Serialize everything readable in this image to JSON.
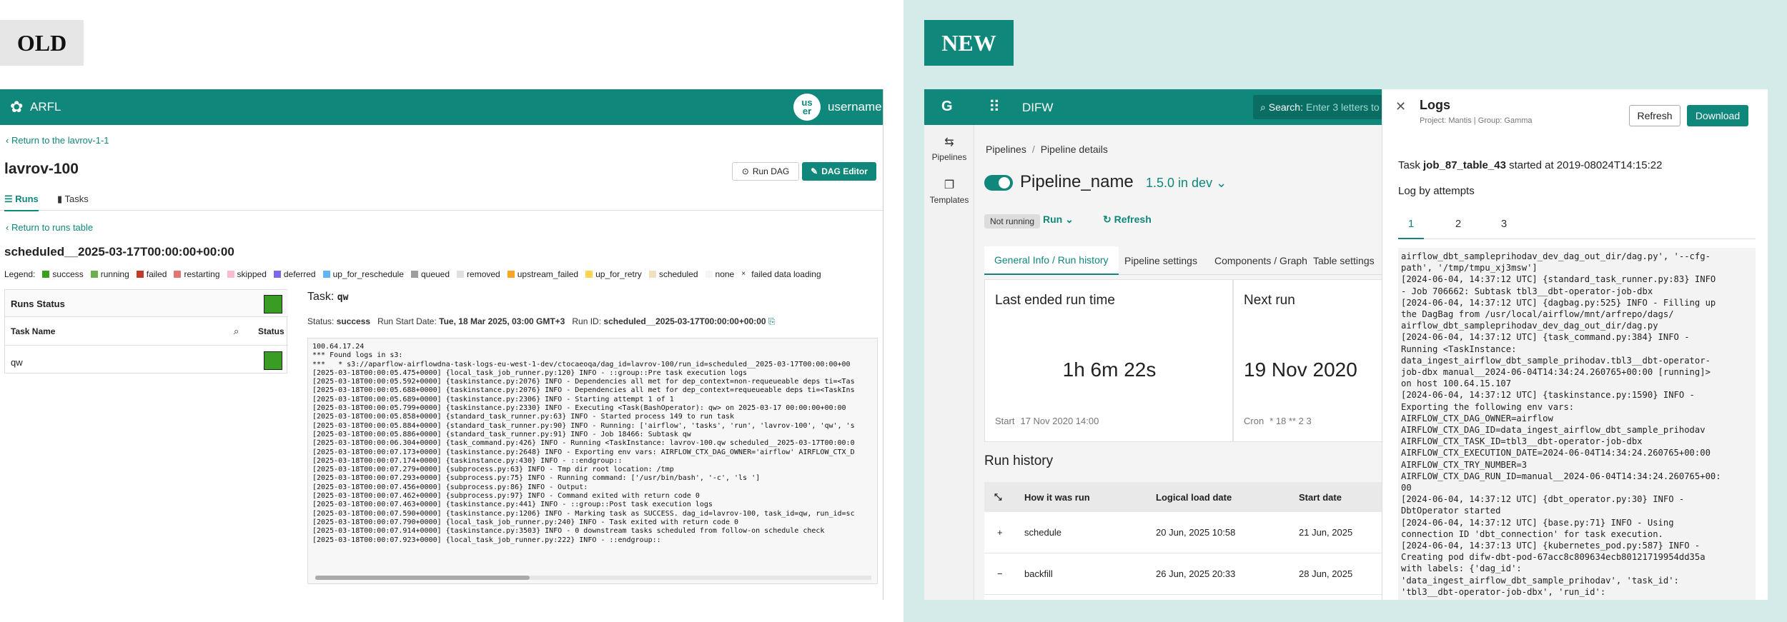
{
  "labels": {
    "old": "OLD",
    "new": "NEW"
  },
  "old": {
    "app_title": "ARFL",
    "avatar_text": "us\ner",
    "username": "username",
    "back_link": "Return to the lavrov-1-1",
    "dag_name": "lavrov-100",
    "run_dag_label": "Run DAG",
    "dag_editor_label": "DAG Editor",
    "tabs": [
      {
        "label": "Runs"
      },
      {
        "label": "Tasks"
      }
    ],
    "back_runs": "Return to runs table",
    "run_title": "scheduled__2025-03-17T00:00:00+00:00",
    "legend_title": "Legend:",
    "legend": [
      {
        "label": "success",
        "color": "#3a9d23"
      },
      {
        "label": "running",
        "color": "#6ab04c"
      },
      {
        "label": "failed",
        "color": "#c0392b"
      },
      {
        "label": "restarting",
        "color": "#e57373"
      },
      {
        "label": "skipped",
        "color": "#f8bbd0"
      },
      {
        "label": "deferred",
        "color": "#7b68ee"
      },
      {
        "label": "up_for_reschedule",
        "color": "#64b5f6"
      },
      {
        "label": "queued",
        "color": "#9e9e9e"
      },
      {
        "label": "removed",
        "color": "#e0e0e0"
      },
      {
        "label": "upstream_failed",
        "color": "#f5a623"
      },
      {
        "label": "up_for_retry",
        "color": "#ffd54f"
      },
      {
        "label": "scheduled",
        "color": "#f0e0c0"
      },
      {
        "label": "none",
        "color": "#f5f5f5"
      },
      {
        "label": "failed data loading",
        "color": "#ffffff"
      }
    ],
    "runs_status_label": "Runs Status",
    "task_name_label": "Task Name",
    "status_label": "Status",
    "task_row": "qw",
    "task_title": "Task:",
    "task_title_value": "qw",
    "status_key": "Status:",
    "status_val": "success",
    "start_key": "Run Start Date:",
    "start_val": "Tue, 18 Mar 2025, 03:00 GMT+3",
    "runid_key": "Run ID:",
    "runid_val": "scheduled__2025-03-17T00:00:00+00:00",
    "log_lines": [
      "100.64.17.24",
      "*** Found logs in s3:",
      "***   * s3://aparflow-airflowdna-task-logs-eu-west-1-dev/ctocaeoqa/dag_id=lavrov-100/run_id=scheduled__2025-03-17T00:00:00+00",
      "[2025-03-18T00:00:05.475+0000] {local_task_job_runner.py:120} INFO - ::group::Pre task execution logs",
      "[2025-03-18T00:00:05.592+0000] {taskinstance.py:2076} INFO - Dependencies all met for dep_context=non-requeueable deps ti=<Tas",
      "[2025-03-18T00:00:05.688+0000] {taskinstance.py:2076} INFO - Dependencies all met for dep_context=requeueable deps ti=<TaskIns",
      "[2025-03-18T00:00:05.689+0000] {taskinstance.py:2306} INFO - Starting attempt 1 of 1",
      "[2025-03-18T00:00:05.799+0000] {taskinstance.py:2330} INFO - Executing <Task(BashOperator): qw> on 2025-03-17 00:00:00+00:00",
      "[2025-03-18T00:00:05.858+0000] {standard_task_runner.py:63} INFO - Started process 149 to run task",
      "[2025-03-18T00:00:05.884+0000] {standard_task_runner.py:90} INFO - Running: ['airflow', 'tasks', 'run', 'lavrov-100', 'qw', 's",
      "[2025-03-18T00:00:05.886+0000] {standard_task_runner.py:91} INFO - Job 18466: Subtask qw",
      "[2025-03-18T00:00:06.304+0000] {task_command.py:426} INFO - Running <TaskInstance: lavrov-100.qw scheduled__2025-03-17T00:00:0",
      "[2025-03-18T00:00:07.173+0000] {taskinstance.py:2648} INFO - Exporting env vars: AIRFLOW_CTX_DAG_OWNER='airflow' AIRFLOW_CTX_D",
      "[2025-03-18T00:00:07.174+0000] {taskinstance.py:430} INFO - ::endgroup::",
      "[2025-03-18T00:00:07.279+0000] {subprocess.py:63} INFO - Tmp dir root location: /tmp",
      "[2025-03-18T00:00:07.293+0000] {subprocess.py:75} INFO - Running command: ['/usr/bin/bash', '-c', 'ls ']",
      "[2025-03-18T00:00:07.456+0000] {subprocess.py:86} INFO - Output:",
      "[2025-03-18T00:00:07.462+0000] {subprocess.py:97} INFO - Command exited with return code 0",
      "[2025-03-18T00:00:07.463+0000] {taskinstance.py:441} INFO - ::group::Post task execution logs",
      "[2025-03-18T00:00:07.590+0000] {taskinstance.py:1206} INFO - Marking task as SUCCESS. dag_id=lavrov-100, task_id=qw, run_id=sc",
      "[2025-03-18T00:00:07.790+0000] {local_task_job_runner.py:240} INFO - Task exited with return code 0",
      "[2025-03-18T00:00:07.914+0000] {taskinstance.py:3503} INFO - 0 downstream tasks scheduled from follow-on schedule check",
      "[2025-03-18T00:00:07.923+0000] {local_task_job_runner.py:222} INFO - ::endgroup::"
    ]
  },
  "new": {
    "app_title": "DIFW",
    "search_label": "Search:",
    "search_placeholder": "Enter 3 letters to",
    "sidebar": [
      {
        "label": "Pipelines",
        "icon": "pipelines-icon"
      },
      {
        "label": "Templates",
        "icon": "templates-icon"
      }
    ],
    "breadcrumb": [
      "Pipelines",
      "Pipeline details"
    ],
    "pipeline_name": "Pipeline_name",
    "version": "1.5.0 in dev",
    "not_running": "Not running",
    "run_label": "Run",
    "refresh_label": "Refresh",
    "tabs": [
      "General Info / Run history",
      "Pipeline settings",
      "Components / Graph",
      "Table settings"
    ],
    "last_run_title": "Last ended run time",
    "last_run_value": "1h 6m 22s",
    "start_label": "Start",
    "start_value": "17 Nov 2020 14:00",
    "next_run_title": "Next run",
    "next_run_value": "19 Nov 2020",
    "cron_label": "Cron",
    "cron_value": "* 18 ** 2 3",
    "run_history_title": "Run history",
    "table_headers": [
      "How it was run",
      "Logical load date",
      "Start date"
    ],
    "rows": [
      {
        "sign": "+",
        "how": "schedule",
        "logical": "20 Jun, 2025 10:58",
        "start": "21 Jun, 2025"
      },
      {
        "sign": "−",
        "how": "backfill",
        "logical": "26 Jun, 2025 20:33",
        "start": "28 Jun, 2025"
      }
    ],
    "logs": {
      "title": "Logs",
      "subtitle": "Project: Mantis | Group: Gamma",
      "refresh": "Refresh",
      "download": "Download",
      "task_prefix": "Task",
      "task_id": "job_87_table_43",
      "task_suffix": "started at 2019-08024T14:15:22",
      "attempts_label": "Log by attempts",
      "attempts": [
        "1",
        "2",
        "3"
      ],
      "lines": [
        "airflow_dbt_sampleprihodav_dev_dag_out_dir/dag.py', '--cfg-",
        "path', '/tmp/tmpu_xj3msw']",
        "[2024-06-04, 14:37:12 UTC] {standard_task_runner.py:83} INFO",
        "- Job 706662: Subtask tbl3__dbt-operator-job-dbx",
        "[2024-06-04, 14:37:12 UTC] {dagbag.py:525} INFO - Filling up",
        "the DagBag from /usr/local/airflow/mnt/arfrepo/dags/",
        "airflow_dbt_sampleprihodav_dev_dag_out_dir/dag.py",
        "[2024-06-04, 14:37:12 UTC] {task_command.py:384} INFO -",
        "Running <TaskInstance:",
        "data_ingest_airflow_dbt_sample_prihodav.tbl3__dbt-operator-",
        "job-dbx manual__2024-06-04T14:34:24.260765+00:00 [running]>",
        "on host 100.64.15.107",
        "[2024-06-04, 14:37:12 UTC] {taskinstance.py:1590} INFO -",
        "Exporting the following env vars:",
        "AIRFLOW_CTX_DAG_OWNER=airflow",
        "AIRFLOW_CTX_DAG_ID=data_ingest_airflow_dbt_sample_prihodav",
        "AIRFLOW_CTX_TASK_ID=tbl3__dbt-operator-job-dbx",
        "AIRFLOW_CTX_EXECUTION_DATE=2024-06-04T14:34:24.260765+00:00",
        "AIRFLOW_CTX_TRY_NUMBER=3",
        "AIRFLOW_CTX_DAG_RUN_ID=manual__2024-06-04T14:34:24.260765+00:",
        "00",
        "[2024-06-04, 14:37:12 UTC] {dbt_operator.py:30} INFO -",
        "DbtOperator started",
        "[2024-06-04, 14:37:12 UTC] {base.py:71} INFO - Using",
        "connection ID 'dbt_connection' for task execution.",
        "[2024-06-04, 14:37:13 UTC] {kubernetes_pod.py:587} INFO -",
        "Creating pod difw-dbt-pod-67acc8c809634ecb80121719954dd35a",
        "with labels: {'dag_id':",
        "'data_ingest_airflow_dbt_sample_prihodav', 'task_id':",
        "'tbl3__dbt-operator-job-dbx', 'run_id':"
      ]
    }
  }
}
